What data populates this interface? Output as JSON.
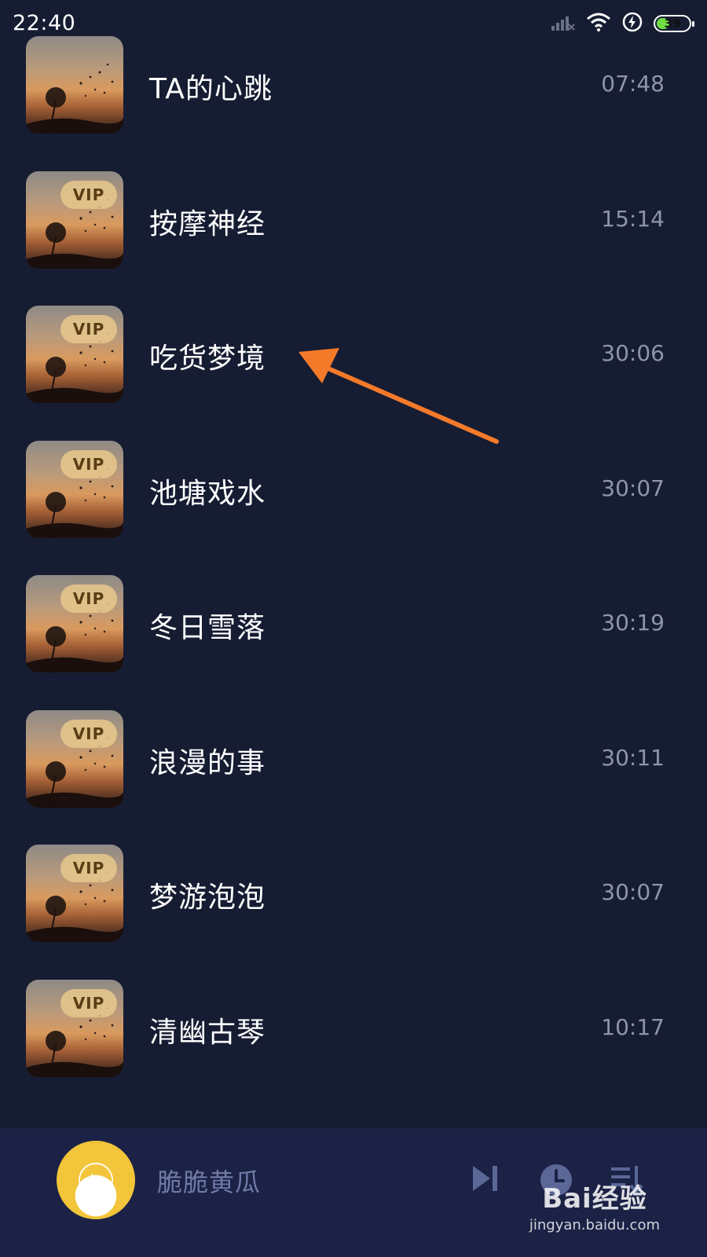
{
  "status_bar": {
    "time": "22:40",
    "battery": "39",
    "icons": [
      "signal-icon",
      "wifi-icon",
      "charging-icon",
      "battery-icon"
    ]
  },
  "tracks": [
    {
      "title": "TA的心跳",
      "duration": "07:48",
      "vip": false
    },
    {
      "title": "按摩神经",
      "duration": "15:14",
      "vip": true
    },
    {
      "title": "吃货梦境",
      "duration": "30:06",
      "vip": true
    },
    {
      "title": "池塘戏水",
      "duration": "30:07",
      "vip": true
    },
    {
      "title": "冬日雪落",
      "duration": "30:19",
      "vip": true
    },
    {
      "title": "浪漫的事",
      "duration": "30:11",
      "vip": true
    },
    {
      "title": "梦游泡泡",
      "duration": "30:07",
      "vip": true
    },
    {
      "title": "清幽古琴",
      "duration": "10:17",
      "vip": true
    }
  ],
  "vip_label": "VIP",
  "player": {
    "title": "脆脆黄瓜",
    "controls": [
      "next-track-icon",
      "timer-icon",
      "playlist-icon"
    ]
  },
  "watermark": {
    "brand": "Bai经验",
    "url": "jingyan.baidu.com"
  },
  "colors": {
    "background": "#161c32",
    "player_bar": "#1b2246",
    "annotation_arrow": "#f47a2a",
    "vip_badge": "#e8c88c",
    "duration_text": "#8e95ab",
    "player_control": "#5b6796"
  }
}
